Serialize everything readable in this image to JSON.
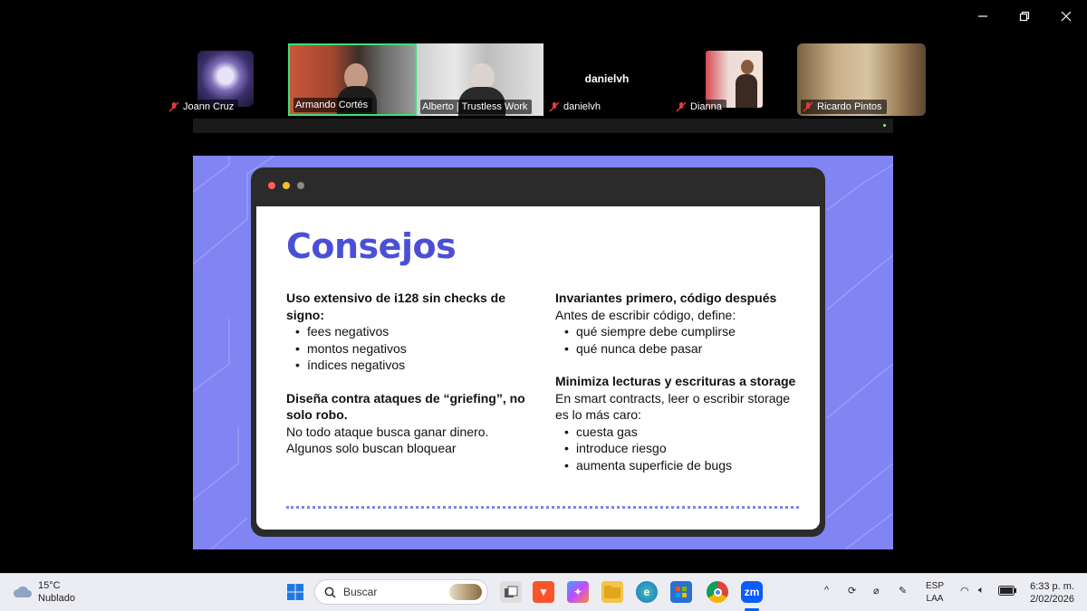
{
  "participants": [
    {
      "name": "Joann Cruz",
      "muted": true
    },
    {
      "name": "Armando Cortés",
      "muted": false,
      "active": true
    },
    {
      "name": "Alberto | Trustless Work",
      "muted": false
    },
    {
      "name": "danielvh",
      "muted": true,
      "display_name": "danielvh"
    },
    {
      "name": "Dianna",
      "muted": true
    },
    {
      "name": "Ricardo Pintos",
      "muted": true
    }
  ],
  "slide": {
    "title": "Consejos",
    "left_col": {
      "block1_title": "Uso extensivo de i128 sin checks de signo:",
      "block1_items": [
        "fees negativos",
        "montos negativos",
        "índices negativos"
      ],
      "block2_title": "Diseña contra ataques de “griefing”, no solo robo.",
      "block2_line1": "No todo ataque busca ganar dinero.",
      "block2_line2": "Algunos solo buscan bloquear"
    },
    "right_col": {
      "block1_title": "Invariantes primero, código después",
      "block1_intro": "Antes de escribir código, define:",
      "block1_items": [
        "qué siempre debe cumplirse",
        "qué nunca debe pasar"
      ],
      "block2_title": "Minimiza lecturas y escrituras a storage",
      "block2_intro1": "En smart contracts, leer o escribir storage",
      "block2_intro2": "es lo más caro:",
      "block2_items": [
        "cuesta gas",
        "introduce riesgo",
        "aumenta superficie de bugs"
      ]
    },
    "colors": {
      "accent": "#4a50d6",
      "background": "#8085f3"
    }
  },
  "taskbar": {
    "weather_temp": "15°C",
    "weather_desc": "Nublado",
    "search_placeholder": "Buscar",
    "zoom_label": "zm",
    "lang_line1": "ESP",
    "lang_line2": "LAA",
    "time": "6:33 p. m.",
    "date": "2/02/2026"
  }
}
